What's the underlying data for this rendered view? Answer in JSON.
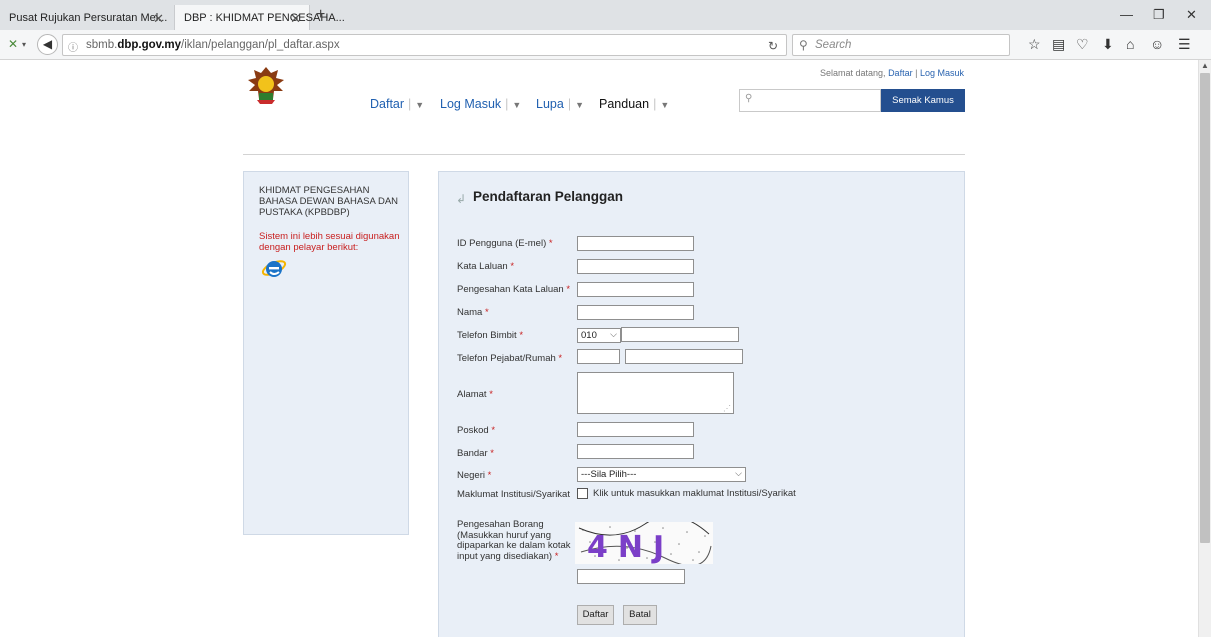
{
  "browser": {
    "tabs": [
      {
        "title": "Pusat Rujukan Persuratan Mel..."
      },
      {
        "title": "DBP : KHIDMAT PENGESAHA..."
      }
    ],
    "url_prefix": "sbmb.",
    "url_domain": "dbp.gov.my",
    "url_path": "/iklan/pelanggan/pl_daftar.aspx",
    "search_placeholder": "Search"
  },
  "header": {
    "welcome_text": "Selamat datang,",
    "welcome_register": "Daftar",
    "welcome_sep": "|",
    "welcome_login": "Log Masuk",
    "menu": [
      {
        "label": "Daftar"
      },
      {
        "label": "Log Masuk"
      },
      {
        "label": "Lupa"
      },
      {
        "label": "Panduan"
      }
    ],
    "kamus_button": "Semak Kamus"
  },
  "sidebar": {
    "org_name": "KHIDMAT PENGESAHAN BAHASA DEWAN BAHASA DAN PUSTAKA (KPBDBP)",
    "browser_notice": "Sistem ini lebih sesuai digunakan dengan pelayar berikut:"
  },
  "form": {
    "title": "Pendaftaran Pelanggan",
    "required_mark": "*",
    "fields": {
      "user_id": "ID Pengguna (E-mel)",
      "password": "Kata Laluan",
      "password_confirm": "Pengesahan Kata Laluan",
      "name": "Nama",
      "mobile": "Telefon Bimbit",
      "mobile_prefix": "010",
      "office_phone": "Telefon Pejabat/Rumah",
      "address": "Alamat",
      "postcode": "Poskod",
      "city": "Bandar",
      "state": "Negeri",
      "state_selected": "---Sila Pilih---",
      "institution": "Maklumat Institusi/Syarikat",
      "institution_check": "Klik untuk masukkan maklumat Institusi/Syarikat",
      "captcha": "Pengesahan Borang (Masukkan huruf yang dipaparkan ke dalam kotak input yang disediakan)",
      "captcha_text": "4NJ"
    },
    "submit_label": "Daftar",
    "cancel_label": "Batal"
  },
  "colors": {
    "accent": "#244f8f",
    "link": "#2060b0",
    "required": "#c81e1e",
    "panel_bg": "#e9eff7"
  }
}
